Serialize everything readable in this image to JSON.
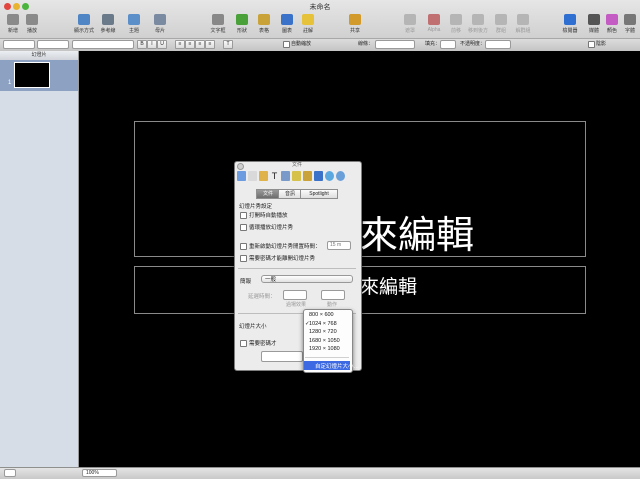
{
  "window": {
    "title": "未命名"
  },
  "toolbar": {
    "left": [
      {
        "name": "new",
        "label": "新增",
        "color": "#8a8a8a"
      },
      {
        "name": "play",
        "label": "播放",
        "color": "#8a8a8a"
      }
    ],
    "view": [
      {
        "name": "view-mode",
        "label": "顯示方式",
        "color": "#4f85c4"
      },
      {
        "name": "guides",
        "label": "參考線",
        "color": "#6b7a8a"
      },
      {
        "name": "theme",
        "label": "主題",
        "color": "#5b8fc9"
      },
      {
        "name": "master",
        "label": "母片",
        "color": "#7a8aa0"
      }
    ],
    "insert": [
      {
        "name": "textbox",
        "label": "文字框",
        "color": "#888"
      },
      {
        "name": "shape",
        "label": "形狀",
        "color": "#4aa13a"
      },
      {
        "name": "table",
        "label": "表格",
        "color": "#c9a23a"
      },
      {
        "name": "chart",
        "label": "圖表",
        "color": "#3a72c9"
      },
      {
        "name": "comment",
        "label": "註解",
        "color": "#e6c23a"
      }
    ],
    "share": {
      "name": "share",
      "label": "共享",
      "color": "#d19a2a"
    },
    "dim": [
      {
        "name": "mask",
        "label": "遮罩",
        "color": "#b5b5b5"
      },
      {
        "name": "alpha",
        "label": "Alpha",
        "color": "#c07070"
      },
      {
        "name": "front",
        "label": "前移",
        "color": "#b5b5b5"
      },
      {
        "name": "back",
        "label": "移到後方",
        "color": "#b5b5b5"
      },
      {
        "name": "group",
        "label": "群組",
        "color": "#b5b5b5"
      },
      {
        "name": "ungroup",
        "label": "解群組",
        "color": "#b5b5b5"
      }
    ],
    "right": [
      {
        "name": "inspector",
        "label": "檢閱器",
        "color": "#2f6fd1"
      },
      {
        "name": "media",
        "label": "媒體",
        "color": "#555"
      },
      {
        "name": "colors",
        "label": "顏色",
        "color": "#c45ac4"
      },
      {
        "name": "fonts",
        "label": "字體",
        "color": "#777"
      }
    ]
  },
  "format_bar": {
    "size_label": "線條：",
    "fill_label": "填充：",
    "opacity_label": "不透明度：",
    "shadow_label": "陰影",
    "reflection_label": "自動縮放"
  },
  "sidebar": {
    "title": "幻燈片",
    "slide_number": "1"
  },
  "slide": {
    "title": "按一下來編輯",
    "title_visible": "來編輯",
    "subtitle_visible": "來編輯"
  },
  "status": {
    "zoom": "100%"
  },
  "inspector": {
    "title": "文件",
    "tabs": [
      "文件",
      "音訊",
      "Spotlight"
    ],
    "section_slideshow": "幻燈片秀設定",
    "autoplay": "打開時自動播放",
    "loop": "循環播放幻燈片秀",
    "restart": "重新啟動幻燈片秀閒置時間：",
    "restart_value": "15 m",
    "password_exit": "需要密碼才能離開幻燈片秀",
    "presentation_label": "簡報",
    "presentation_value": "一般",
    "delay_label": "延遲時間：",
    "transition_label": "過場效果",
    "build_label": "動作",
    "slide_size_label": "幻燈片大小",
    "password_open": "需要密碼才"
  },
  "size_menu": {
    "options": [
      "800 × 600",
      "1024 × 768",
      "1280 × 720",
      "1680 × 1050",
      "1920 × 1080"
    ],
    "checked": "1024 × 768",
    "custom": "自定幻燈片大小…"
  }
}
